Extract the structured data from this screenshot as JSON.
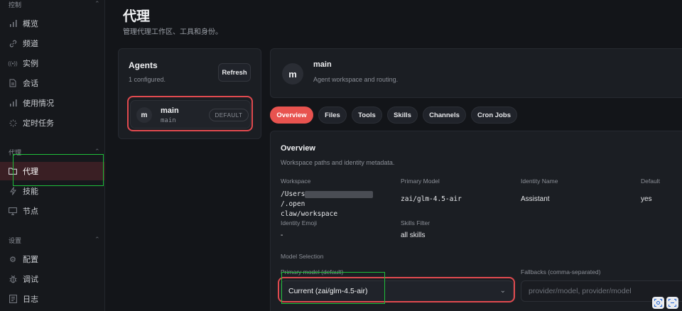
{
  "sidebar": {
    "section_control": "控制",
    "control_items": [
      {
        "label": "概览",
        "icon": "bar-chart-icon"
      },
      {
        "label": "频道",
        "icon": "link-icon"
      },
      {
        "label": "实例",
        "icon": "broadcast-icon"
      },
      {
        "label": "会话",
        "icon": "document-icon"
      },
      {
        "label": "使用情况",
        "icon": "bar-chart-icon"
      },
      {
        "label": "定时任务",
        "icon": "loader-icon"
      }
    ],
    "section_agent": "代理",
    "agent_items": [
      {
        "label": "代理",
        "icon": "folder-icon",
        "active": true
      },
      {
        "label": "技能",
        "icon": "lightning-icon"
      },
      {
        "label": "节点",
        "icon": "monitor-icon"
      }
    ],
    "section_settings": "设置",
    "settings_items": [
      {
        "label": "配置",
        "icon": "gear-icon"
      },
      {
        "label": "调试",
        "icon": "bug-icon"
      },
      {
        "label": "日志",
        "icon": "log-icon"
      }
    ]
  },
  "header": {
    "title": "代理",
    "subtitle": "管理代理工作区、工具和身份。"
  },
  "agents_panel": {
    "title": "Agents",
    "count": "1 configured.",
    "refresh_label": "Refresh",
    "items": [
      {
        "avatar": "m",
        "name": "main",
        "id": "main",
        "badge": "DEFAULT"
      }
    ]
  },
  "agent_header": {
    "avatar": "m",
    "name": "main",
    "description": "Agent workspace and routing."
  },
  "tabs": [
    {
      "label": "Overview",
      "active": true
    },
    {
      "label": "Files"
    },
    {
      "label": "Tools"
    },
    {
      "label": "Skills"
    },
    {
      "label": "Channels"
    },
    {
      "label": "Cron Jobs"
    }
  ],
  "overview": {
    "title": "Overview",
    "subtitle": "Workspace paths and identity metadata.",
    "workspace_label": "Workspace",
    "workspace_value_pre": "/Users",
    "workspace_value_post": "/.open",
    "workspace_value_line2": "claw/workspace",
    "primary_model_label": "Primary Model",
    "primary_model_value": "zai/glm-4.5-air",
    "identity_name_label": "Identity Name",
    "identity_name_value": "Assistant",
    "default_label": "Default",
    "default_value": "yes",
    "identity_emoji_label": "Identity Emoji",
    "identity_emoji_value": "-",
    "skills_filter_label": "Skills Filter",
    "skills_filter_value": "all skills",
    "model_selection_label": "Model Selection",
    "primary_model_default_label": "Primary model (default)",
    "primary_model_select_value": "Current (zai/glm-4.5-air)",
    "fallbacks_label": "Fallbacks (comma-separated)",
    "fallbacks_placeholder": "provider/model, provider/model"
  },
  "colors": {
    "accent": "#e8534f",
    "highlight_red": "#e04a4f",
    "highlight_green": "#1fbf3a",
    "background": "#131519"
  }
}
